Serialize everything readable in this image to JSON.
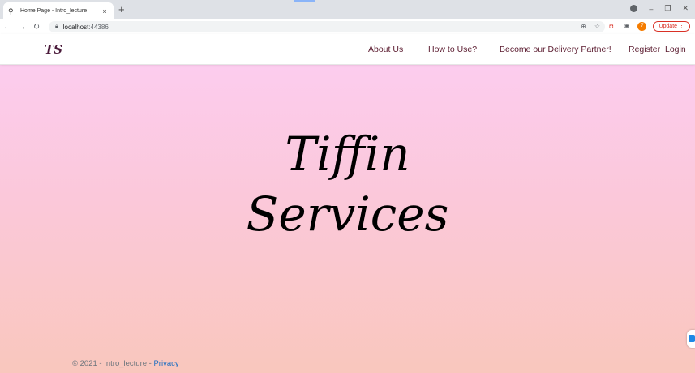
{
  "browser": {
    "tab_title": "Home Page - Intro_lecture",
    "tab_close": "×",
    "new_tab": "+",
    "url_host": "localhost",
    "url_port": ":44386",
    "update_label": "Update",
    "profile_initial": "7",
    "win_minimize": "–",
    "win_restore": "❐",
    "win_close": "✕"
  },
  "navbar": {
    "brand": "TS",
    "links": [
      "About Us",
      "How to Use?",
      "Become our Delivery Partner!",
      "Register",
      "Login"
    ]
  },
  "hero": {
    "line1": "Tiffin",
    "line2": "Services"
  },
  "footer": {
    "text": "© 2021 - Intro_lecture - ",
    "link": "Privacy"
  },
  "colors": {
    "gradient_top": "#fccdf3",
    "gradient_bottom": "#f9c7bd",
    "nav_text": "#5a1a2e",
    "link": "#1b6ec2"
  }
}
